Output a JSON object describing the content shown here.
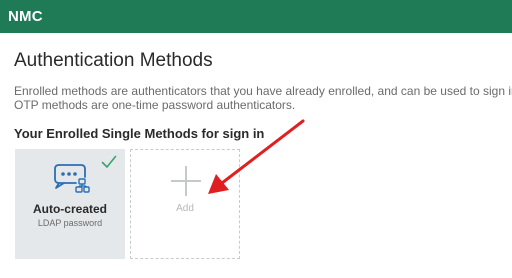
{
  "header": {
    "app_title": "NMC"
  },
  "main": {
    "page_title": "Authentication Methods",
    "description_line1": "Enrolled methods are authenticators that you have already enrolled, and can be used to sign in.",
    "description_line2": "OTP methods are one-time password authenticators.",
    "section_heading": "Your Enrolled Single Methods for sign in",
    "enrolled_methods": [
      {
        "name": "Auto-created",
        "type": "LDAP password",
        "icon": "password-dots-icon",
        "status_icon": "checkmark-icon"
      }
    ],
    "add_card": {
      "label": "Add",
      "icon": "plus-icon"
    }
  },
  "colors": {
    "brand": "#1f7a56",
    "check": "#3aa36b",
    "icon_blue": "#2c6fb2",
    "annotation_arrow": "#e02020"
  }
}
